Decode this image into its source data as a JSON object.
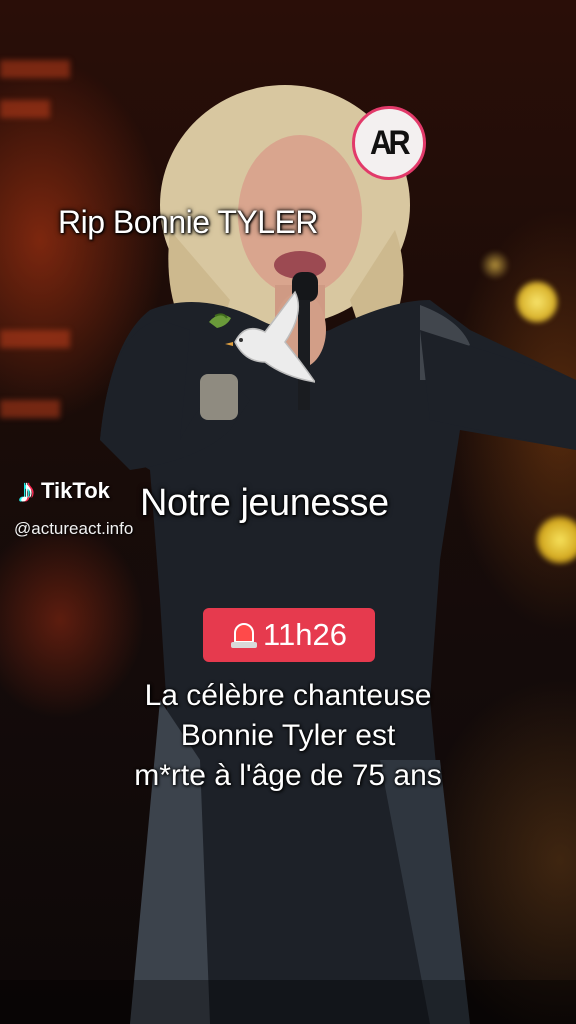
{
  "overlay": {
    "title_caption": "Rip Bonnie TYLER",
    "subtitle_caption": "Notre jeunesse",
    "logo_text": "AR",
    "dove_icon": "white-dove-with-olive-branch"
  },
  "watermark": {
    "brand": "TikTok",
    "handle": "@actureact.info"
  },
  "alert": {
    "icon": "rotating-light-icon",
    "time": "11h26",
    "badge_color": "#e63a4e"
  },
  "news": {
    "lines": [
      "La célèbre chanteuse",
      "Bonnie Tyler est",
      "m*rte à l'âge de 75 ans"
    ]
  }
}
